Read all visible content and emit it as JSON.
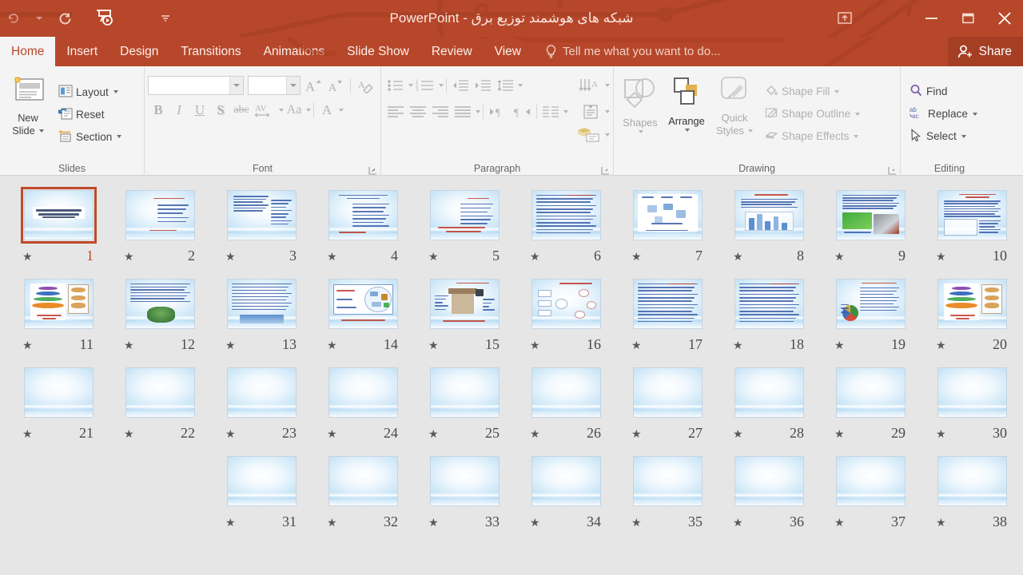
{
  "window": {
    "title": "شبکه های هوشمند توزیع برق - PowerPoint",
    "accent_color": "#b7472a",
    "ribbon_bg": "#f4f4f4",
    "selection_color": "#c0492a",
    "quick_access": [
      {
        "name": "autosave-undo-icon",
        "glyph": "↺"
      },
      {
        "name": "customize-qat-caret-icon",
        "glyph": "▾"
      },
      {
        "name": "redo-icon",
        "glyph": "↻"
      },
      {
        "name": "start-slideshow-icon",
        "glyph": "▶"
      },
      {
        "name": "qat-overflow-icon",
        "glyph": "▾"
      }
    ],
    "controls": {
      "ribbon_display_options": "ribbon-display-options-icon",
      "minimize": "minimize-icon",
      "restore": "restore-icon",
      "close": "close-icon"
    }
  },
  "tabs": [
    {
      "label": "Home",
      "active": true
    },
    {
      "label": "Insert",
      "active": false
    },
    {
      "label": "Design",
      "active": false
    },
    {
      "label": "Transitions",
      "active": false
    },
    {
      "label": "Animations",
      "active": false
    },
    {
      "label": "Slide Show",
      "active": false
    },
    {
      "label": "Review",
      "active": false
    },
    {
      "label": "View",
      "active": false
    }
  ],
  "tell_me": {
    "placeholder": "Tell me what you want to do...",
    "icon": "lightbulb-icon"
  },
  "share": {
    "label": "Share",
    "icon": "person-add-icon"
  },
  "ribbon": {
    "groups": [
      {
        "name": "Slides",
        "label": "Slides",
        "new_slide": {
          "label_line1": "New",
          "label_line2": "Slide",
          "disabled": false
        },
        "items": [
          {
            "label": "Layout",
            "has_caret": true,
            "disabled": false
          },
          {
            "label": "Reset",
            "has_caret": false,
            "disabled": false
          },
          {
            "label": "Section",
            "has_caret": true,
            "disabled": false
          }
        ]
      },
      {
        "name": "Font",
        "label": "Font",
        "font_name": {
          "value": "",
          "placeholder": ""
        },
        "font_size": {
          "value": "",
          "placeholder": ""
        },
        "buttons": [
          {
            "name": "increase-font-size-button",
            "glyph": "A▴"
          },
          {
            "name": "decrease-font-size-button",
            "glyph": "A▾"
          },
          {
            "name": "clear-formatting-button",
            "glyph": "A⌫"
          },
          {
            "name": "bold-button",
            "glyph": "B"
          },
          {
            "name": "italic-button",
            "glyph": "I"
          },
          {
            "name": "underline-button",
            "glyph": "U"
          },
          {
            "name": "text-shadow-button",
            "glyph": "S"
          },
          {
            "name": "strikethrough-button",
            "glyph": "abc"
          },
          {
            "name": "character-spacing-button",
            "glyph": "AV"
          },
          {
            "name": "change-case-button",
            "glyph": "Aa"
          },
          {
            "name": "font-color-button",
            "glyph": "A"
          }
        ]
      },
      {
        "name": "Paragraph",
        "label": "Paragraph",
        "buttons": [
          {
            "name": "bullets-button"
          },
          {
            "name": "numbering-button"
          },
          {
            "name": "decrease-indent-button"
          },
          {
            "name": "increase-indent-button"
          },
          {
            "name": "line-spacing-button"
          },
          {
            "name": "text-direction-button"
          },
          {
            "name": "align-left-button"
          },
          {
            "name": "center-button"
          },
          {
            "name": "align-right-button"
          },
          {
            "name": "justify-button"
          },
          {
            "name": "ltr-paragraph-button"
          },
          {
            "name": "rtl-paragraph-button"
          },
          {
            "name": "columns-button"
          },
          {
            "name": "align-text-button"
          },
          {
            "name": "convert-to-smartart-button"
          }
        ]
      },
      {
        "name": "Drawing",
        "label": "Drawing",
        "shapes": {
          "label": "Shapes",
          "has_caret": true,
          "disabled": true
        },
        "arrange": {
          "label": "Arrange",
          "has_caret": true,
          "disabled": false
        },
        "quick_styles": {
          "label_line1": "Quick",
          "label_line2": "Styles",
          "has_caret": true,
          "disabled": true
        },
        "items": [
          {
            "label": "Shape Fill",
            "has_caret": true,
            "disabled": true,
            "icon": "fill-bucket-icon"
          },
          {
            "label": "Shape Outline",
            "has_caret": true,
            "disabled": true,
            "icon": "pencil-outline-icon"
          },
          {
            "label": "Shape Effects",
            "has_caret": true,
            "disabled": true,
            "icon": "effects-icon"
          }
        ]
      },
      {
        "name": "Editing",
        "label": "Editing",
        "items": [
          {
            "label": "Find",
            "has_caret": false,
            "disabled": false,
            "icon": "magnifier-icon"
          },
          {
            "label": "Replace",
            "has_caret": true,
            "disabled": false,
            "icon": "replace-abac-icon"
          },
          {
            "label": "Select",
            "has_caret": true,
            "disabled": false,
            "icon": "cursor-arrow-icon"
          }
        ]
      }
    ]
  },
  "slide_sorter": {
    "view": "slide-sorter",
    "direction": "rtl",
    "selected_slide": 1,
    "rows": [
      {
        "slides": [
          {
            "number": 10,
            "kind": "text-table",
            "star": "★"
          },
          {
            "number": 9,
            "kind": "text-photo",
            "star": "★"
          },
          {
            "number": 8,
            "kind": "text-chart",
            "star": "★"
          },
          {
            "number": 7,
            "kind": "diagram",
            "star": "★"
          },
          {
            "number": 6,
            "kind": "text-dense",
            "star": "★"
          },
          {
            "number": 5,
            "kind": "text-sparse",
            "star": "★"
          },
          {
            "number": 4,
            "kind": "text-wide",
            "star": "★"
          },
          {
            "number": 3,
            "kind": "text-list",
            "star": "★"
          },
          {
            "number": 2,
            "kind": "text-short",
            "star": "★"
          },
          {
            "number": 1,
            "kind": "title-arabic",
            "star": "★",
            "selected": true
          }
        ]
      },
      {
        "slides": [
          {
            "number": 20,
            "kind": "pyramid-graphic",
            "star": "★"
          },
          {
            "number": 19,
            "kind": "text-pie",
            "star": "★"
          },
          {
            "number": 18,
            "kind": "text-dense",
            "star": "★"
          },
          {
            "number": 17,
            "kind": "text-dense",
            "star": "★"
          },
          {
            "number": 16,
            "kind": "flow-diagram",
            "star": "★"
          },
          {
            "number": 15,
            "kind": "house-photo",
            "star": "★"
          },
          {
            "number": 14,
            "kind": "network-diagram",
            "star": "★"
          },
          {
            "number": 13,
            "kind": "text-image",
            "star": "★"
          },
          {
            "number": 12,
            "kind": "text-photo2",
            "star": "★"
          },
          {
            "number": 11,
            "kind": "pyramid-graphic",
            "star": "★"
          }
        ]
      },
      {
        "slides": [
          {
            "number": 30,
            "kind": "blank",
            "star": "★"
          },
          {
            "number": 29,
            "kind": "blank",
            "star": "★"
          },
          {
            "number": 28,
            "kind": "blank",
            "star": "★"
          },
          {
            "number": 27,
            "kind": "blank",
            "star": "★"
          },
          {
            "number": 26,
            "kind": "blank",
            "star": "★"
          },
          {
            "number": 25,
            "kind": "blank",
            "star": "★"
          },
          {
            "number": 24,
            "kind": "blank",
            "star": "★"
          },
          {
            "number": 23,
            "kind": "blank",
            "star": "★"
          },
          {
            "number": 22,
            "kind": "blank",
            "star": "★"
          },
          {
            "number": 21,
            "kind": "blank",
            "star": "★"
          }
        ]
      },
      {
        "slides": [
          {
            "number": 38,
            "kind": "blank",
            "star": "★"
          },
          {
            "number": 37,
            "kind": "blank",
            "star": "★"
          },
          {
            "number": 36,
            "kind": "blank",
            "star": "★"
          },
          {
            "number": 35,
            "kind": "blank",
            "star": "★"
          },
          {
            "number": 34,
            "kind": "blank",
            "star": "★"
          },
          {
            "number": 33,
            "kind": "blank",
            "star": "★"
          },
          {
            "number": 32,
            "kind": "blank",
            "star": "★"
          },
          {
            "number": 31,
            "kind": "blank",
            "star": "★"
          }
        ]
      }
    ]
  }
}
